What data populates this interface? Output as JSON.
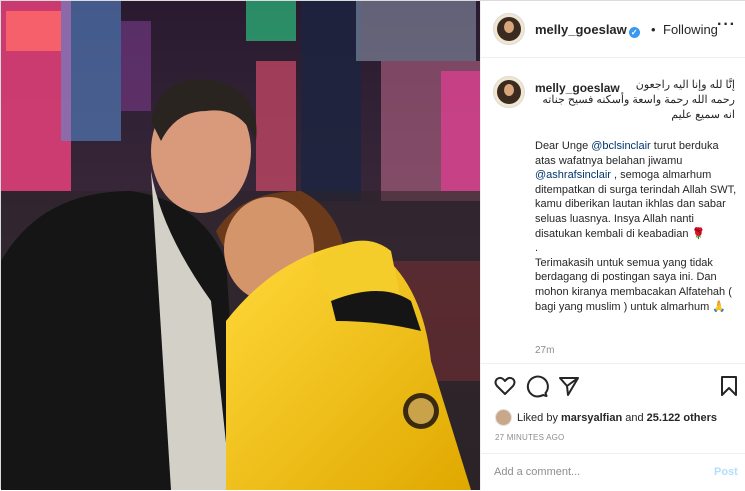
{
  "header": {
    "username": "melly_goeslaw",
    "verified_icon": "verified-badge-icon",
    "dot": "•",
    "follow_status": "Following",
    "more_label": "···"
  },
  "caption": {
    "username": "melly_goeslaw",
    "arabic_line1": "إنَّا لله وإنا اليه راجعون",
    "arabic_line2": "رحمه الله رحمة واسعة وأسكنه فسيح جناته",
    "arabic_line3": "انه سميع عليم",
    "p1_pre": "Dear Unge ",
    "p1_mention1": "@bclsinclair",
    "p1_mid": " turut berduka atas wafatnya belahan jiwamu ",
    "p1_mention2": "@ashrafsinclair",
    "p1_post": " , semoga almarhum ditempatkan di surga terindah Allah SWT, kamu diberikan lautan ikhlas dan sabar seluas luasnya. Insya Allah nanti disatukan kembali di keabadian 🌹",
    "p2": ".",
    "p3": "Terimakasih untuk semua yang tidak berdagang di postingan saya ini. Dan mohon kiranya membacakan Alfatehah ( bagi yang muslim ) untuk almarhum 🙏",
    "time": "27m"
  },
  "actions": {
    "like_icon": "heart-icon",
    "comment_icon": "comment-icon",
    "share_icon": "share-icon",
    "save_icon": "bookmark-icon",
    "liked_by_prefix": "Liked by ",
    "liked_by_user": "marsyalfian",
    "liked_and": " and ",
    "liked_count": "25.122 others",
    "time_ago": "27 MINUTES AGO"
  },
  "comment": {
    "placeholder": "Add a comment...",
    "post_label": "Post"
  },
  "colors": {
    "link": "#00376b",
    "verified": "#3897f0",
    "muted": "#8e8e8e",
    "post_disabled": "#b2dffc",
    "jacket": "#f2c21a"
  }
}
